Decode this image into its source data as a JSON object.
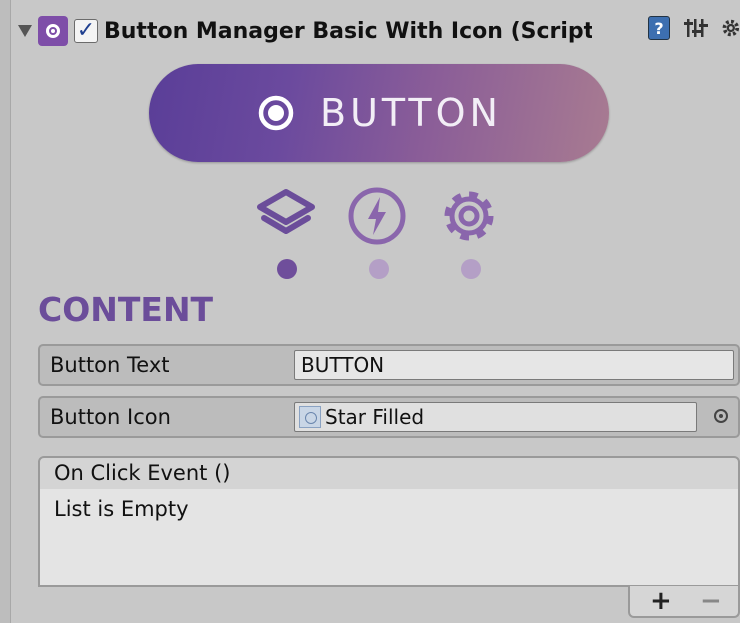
{
  "component": {
    "title": "Button Manager Basic With Icon (Script)",
    "enabled": true
  },
  "preview_button": {
    "label": "BUTTON",
    "gradient_start": "#5a3e98",
    "gradient_end": "#a87b91",
    "icon": "radio-target-icon"
  },
  "tabs": [
    {
      "icon": "layers-icon",
      "active": true
    },
    {
      "icon": "lightning-icon",
      "active": false
    },
    {
      "icon": "gear-icon",
      "active": false
    }
  ],
  "colors": {
    "accent": "#6b4d9a",
    "tab_active": "#6b4d9a",
    "dot_active": "#6f4e9b",
    "dot_inactive": "#b49fc6"
  },
  "content": {
    "section_title": "CONTENT",
    "fields": {
      "button_text": {
        "label": "Button Text",
        "value": "BUTTON"
      },
      "button_icon": {
        "label": "Button Icon",
        "value": "Star Filled"
      }
    }
  },
  "event": {
    "header": "On Click Event ()",
    "empty_text": "List is Empty",
    "add_label": "+",
    "remove_label": "−"
  }
}
